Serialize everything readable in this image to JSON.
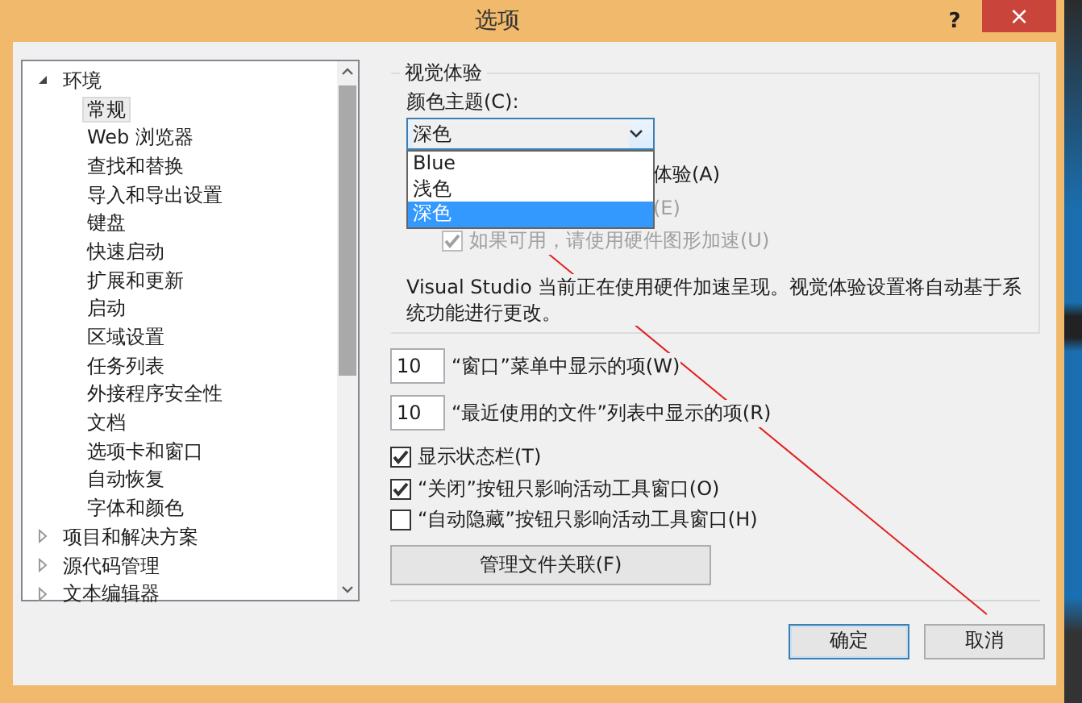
{
  "window": {
    "title": "选项",
    "help": "?",
    "close": "×"
  },
  "tree": [
    {
      "label": "环境",
      "expanded": true,
      "selected": false,
      "children": [
        {
          "label": "常规",
          "selected": true
        },
        {
          "label": "Web 浏览器",
          "selected": false
        },
        {
          "label": "查找和替换",
          "selected": false
        },
        {
          "label": "导入和导出设置",
          "selected": false
        },
        {
          "label": "键盘",
          "selected": false
        },
        {
          "label": "快速启动",
          "selected": false
        },
        {
          "label": "扩展和更新",
          "selected": false
        },
        {
          "label": "启动",
          "selected": false
        },
        {
          "label": "区域设置",
          "selected": false
        },
        {
          "label": "任务列表",
          "selected": false
        },
        {
          "label": "外接程序安全性",
          "selected": false
        },
        {
          "label": "文档",
          "selected": false
        },
        {
          "label": "选项卡和窗口",
          "selected": false
        },
        {
          "label": "自动恢复",
          "selected": false
        },
        {
          "label": "字体和颜色",
          "selected": false
        }
      ]
    },
    {
      "label": "项目和解决方案",
      "expanded": false,
      "selected": false
    },
    {
      "label": "源代码管理",
      "expanded": false,
      "selected": false
    },
    {
      "label": "文本编辑器",
      "expanded": false,
      "selected": false
    }
  ],
  "visual_experience": {
    "legend": "视觉体验",
    "theme_label": "颜色主题(C):",
    "theme_value": "深色",
    "dropdown_open": true,
    "theme_options": [
      {
        "label": "Blue",
        "selected": false
      },
      {
        "label": "浅色",
        "selected": false
      },
      {
        "label": "深色",
        "selected": true
      }
    ],
    "covered_options": [
      {
        "label": "体验(A)",
        "disabled": false
      },
      {
        "label": "(E)",
        "disabled": true
      }
    ],
    "hardware_option": {
      "label": "如果可用，请使用硬件图形加速(U)",
      "checked": true,
      "disabled": true
    },
    "description": "Visual Studio 当前正在使用硬件加速呈现。视觉体验设置将自动基于系统功能进行更改。"
  },
  "counts": [
    {
      "value": "10",
      "label": "“窗口”菜单中显示的项(W)"
    },
    {
      "value": "10",
      "label": "“最近使用的文件”列表中显示的项(R)"
    }
  ],
  "checkboxes": [
    {
      "label": "显示状态栏(T)",
      "checked": true
    },
    {
      "label": "“关闭”按钮只影响活动工具窗口(O)",
      "checked": true
    },
    {
      "label": "“自动隐藏”按钮只影响活动工具窗口(H)",
      "checked": false
    }
  ],
  "manage_button": "管理文件关联(F)",
  "buttons": [
    {
      "label": "确定",
      "default": true
    },
    {
      "label": "取消",
      "default": false
    }
  ]
}
